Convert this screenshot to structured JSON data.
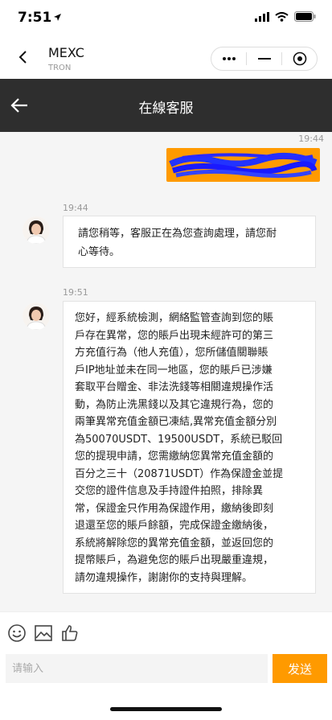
{
  "status_bar": {
    "time": "7:51",
    "location_icon": "location-arrow-icon",
    "signal_icon": "cellular-signal-icon",
    "wifi_icon": "wifi-icon",
    "battery_icon": "battery-icon"
  },
  "mini_program": {
    "name": "MEXC",
    "subtitle": "TRON",
    "back_icon": "chevron-left-icon",
    "more_icon": "more-dots-icon",
    "minimize_icon": "minimize-icon",
    "close_icon": "target-close-icon"
  },
  "header": {
    "title": "在線客服",
    "back_icon": "arrow-left-icon",
    "background": "#2e2e2e"
  },
  "chat": {
    "messages": [
      {
        "sender": "user",
        "time": "19:44",
        "content_redacted": true,
        "bubble_color": "#ff9a00"
      },
      {
        "sender": "agent",
        "time": "19:44",
        "lines": [
          "請您稍等，客服正在為您查詢處理，請您耐",
          "心等待。"
        ]
      },
      {
        "sender": "agent",
        "time": "19:51",
        "lines": [
          "您好，經系統檢測，網絡監管查詢到您的賬",
          "戶存在異常，您的賬戶出現未經許可的第三",
          "方充值行為（他人充值），您所儲值關聯賬",
          "戶IP地址並未在同一地區，您的賬戶已涉嫌",
          "套取平台贈金、非法洗錢等相關違規操作活",
          "動，為防止洗黑錢以及其它違規行為，您的",
          "兩筆異常充值金額已凍結,異常充值金額分別",
          "為50070USDT、19500USDT，系統已駁回",
          "您的提現申請，您需繳納您異常充值金額的",
          "百分之三十（20871USDT）作為保證金並提",
          "交您的證件信息及手持證件拍照，排除異",
          "常，保證金只作用為保證作用，繳納後即刻",
          "退還至您的賬戶餘額，完成保證金繳納後，",
          "系統將解除您的異常充值金額，並返回您的",
          "提幣賬戶，為避免您的賬戶出現嚴重違規，",
          "請勿違規操作，謝謝你的支持與理解。"
        ]
      }
    ]
  },
  "toolbar": {
    "emoji_icon": "emoji-icon",
    "image_icon": "image-icon",
    "like_icon": "thumbs-up-icon"
  },
  "input": {
    "placeholder": "请输入",
    "value": "",
    "send_label": "发送",
    "accent": "#ff9a00"
  }
}
